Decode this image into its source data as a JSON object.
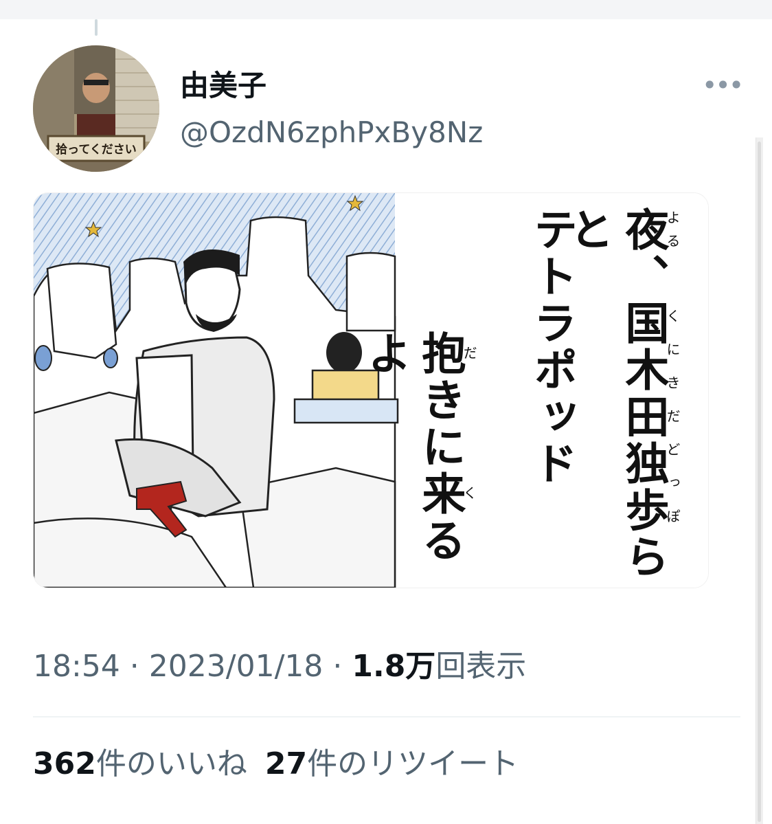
{
  "tweet": {
    "author": {
      "display_name": "由美子",
      "handle": "@OzdN6zphPxBy8Nz",
      "avatar_sign_text": "拾ってください"
    },
    "more_icon": "more-horizontal-icon",
    "image": {
      "columns": [
        {
          "text": "夜、国木田独歩らと",
          "ruby": [
            "よる",
            "くにきだどっぽ"
          ]
        },
        {
          "text": "テトラポッド"
        },
        {
          "text": "抱きに来るよ",
          "ruby": [
            "だ",
            "く"
          ]
        }
      ]
    },
    "time": "18:54",
    "separator": " · ",
    "date": "2023/01/18",
    "views_count": "1.8万",
    "views_label": "回表示",
    "likes_count": "362",
    "likes_label": "件のいいね",
    "retweets_count": "27",
    "retweets_label": "件のリツイート"
  }
}
